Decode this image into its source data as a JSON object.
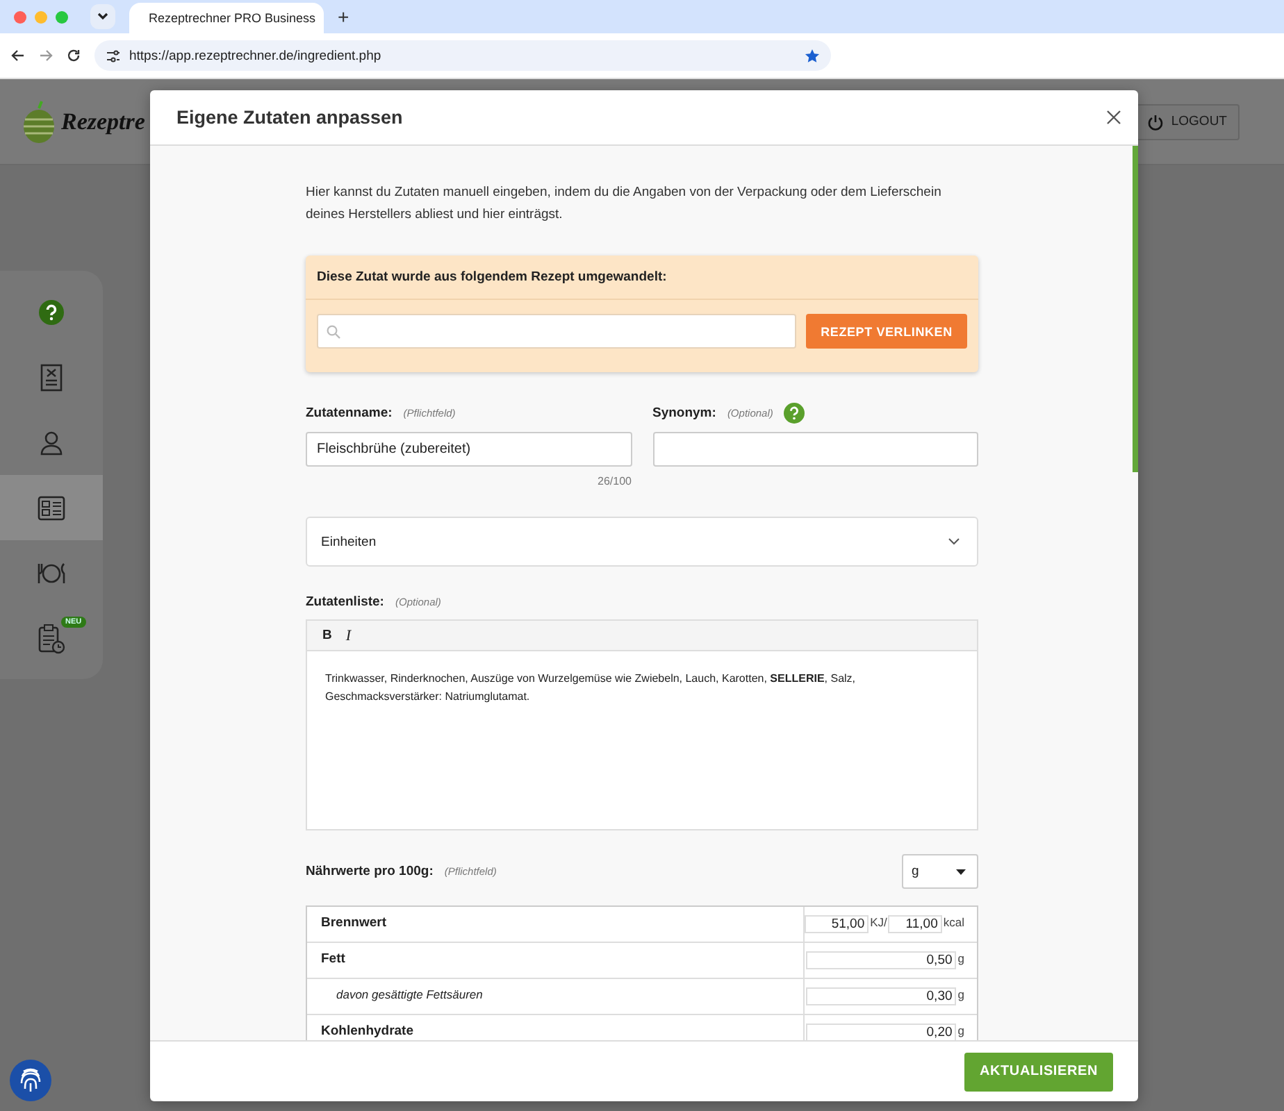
{
  "browser": {
    "tab_title": "Rezeptrechner PRO Business",
    "new_tab": "+",
    "url": "https://app.rezeptrechner.de/ingredient.php"
  },
  "app": {
    "logo_text": "Rezeptre",
    "logout": "LOGOUT",
    "sidebar": [
      {
        "kind": "help",
        "selected": false
      },
      {
        "kind": "document",
        "selected": false
      },
      {
        "kind": "person",
        "selected": false
      },
      {
        "kind": "list",
        "selected": true
      },
      {
        "kind": "plate",
        "selected": false
      },
      {
        "kind": "clipboard",
        "selected": false,
        "badge": "NEU"
      }
    ]
  },
  "modal": {
    "title": "Eigene Zutaten anpassen",
    "intro": "Hier kannst du Zutaten manuell eingeben, indem du die Angaben von der Verpackung oder dem Lieferschein deines Herstellers abliest und hier einträgst.",
    "linked_recipe": {
      "heading": "Diese Zutat wurde aus folgendem Rezept umgewandelt:",
      "button": "REZEPT VERLINKEN"
    },
    "name_field": {
      "label": "Zutatenname:",
      "hint": "(Pflichtfeld)",
      "value": "Fleischbrühe (zubereitet)",
      "counter": "26/100"
    },
    "synonym_field": {
      "label": "Synonym:",
      "hint": "(Optional)"
    },
    "units": {
      "label": "Einheiten",
      "expanded": false
    },
    "ingredient_list": {
      "label": "Zutatenliste:",
      "hint": "(Optional)",
      "toolbar": [
        "B",
        "I"
      ],
      "text": "Trinkwasser, Rinderknochen, Auszüge von Wurzelgemüse wie Zwiebeln, Lauch, Karotten,  **SELLERIE**, Salz, Geschmacksverstärker: Natriumglutamat."
    },
    "nutrition": {
      "label": "Nährwerte pro 100g:",
      "hint": "(Pflichtfeld)",
      "unit_select": "g",
      "rows": [
        {
          "kind": "energy",
          "label": "Brennwert",
          "value": "51,00",
          "unit": "KJ/",
          "value_2": "11,00",
          "unit_2": "kcal"
        },
        {
          "kind": "main",
          "label": "Fett",
          "value": "0,50",
          "unit": "g"
        },
        {
          "kind": "sub",
          "label": "davon gesättigte Fettsäuren",
          "value": "0,30",
          "unit": "g"
        },
        {
          "kind": "main",
          "label": "Kohlenhydrate",
          "value": "0,20",
          "unit": "g"
        }
      ]
    },
    "submit": "AKTUALISIEREN"
  }
}
